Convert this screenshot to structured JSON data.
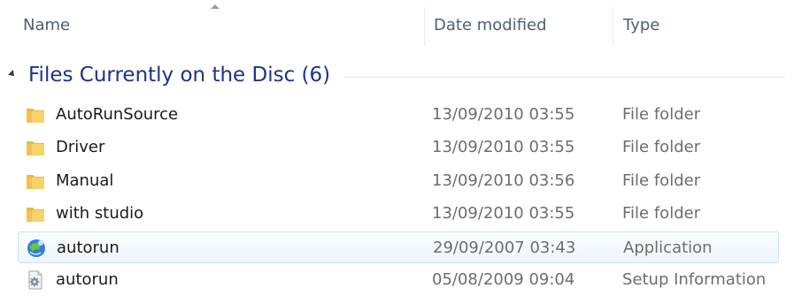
{
  "columns": {
    "name": "Name",
    "date_modified": "Date modified",
    "type": "Type"
  },
  "group": {
    "title": "Files Currently on the Disc (6)"
  },
  "files": [
    {
      "name": "AutoRunSource",
      "date": "13/09/2010 03:55",
      "type": "File folder",
      "icon": "folder-icon"
    },
    {
      "name": "Driver",
      "date": "13/09/2010 03:55",
      "type": "File folder",
      "icon": "folder-icon"
    },
    {
      "name": "Manual",
      "date": "13/09/2010 03:56",
      "type": "File folder",
      "icon": "folder-icon"
    },
    {
      "name": "with studio",
      "date": "13/09/2010 03:55",
      "type": "File folder",
      "icon": "folder-icon"
    },
    {
      "name": "autorun",
      "date": "29/09/2007 03:43",
      "type": "Application",
      "icon": "application-icon"
    },
    {
      "name": "autorun",
      "date": "05/08/2009 09:04",
      "type": "Setup Information",
      "icon": "setup-information-icon"
    }
  ],
  "colors": {
    "group_title": "#1e3287",
    "header_text": "#4c607a",
    "hover_border": "#cde1f7"
  }
}
